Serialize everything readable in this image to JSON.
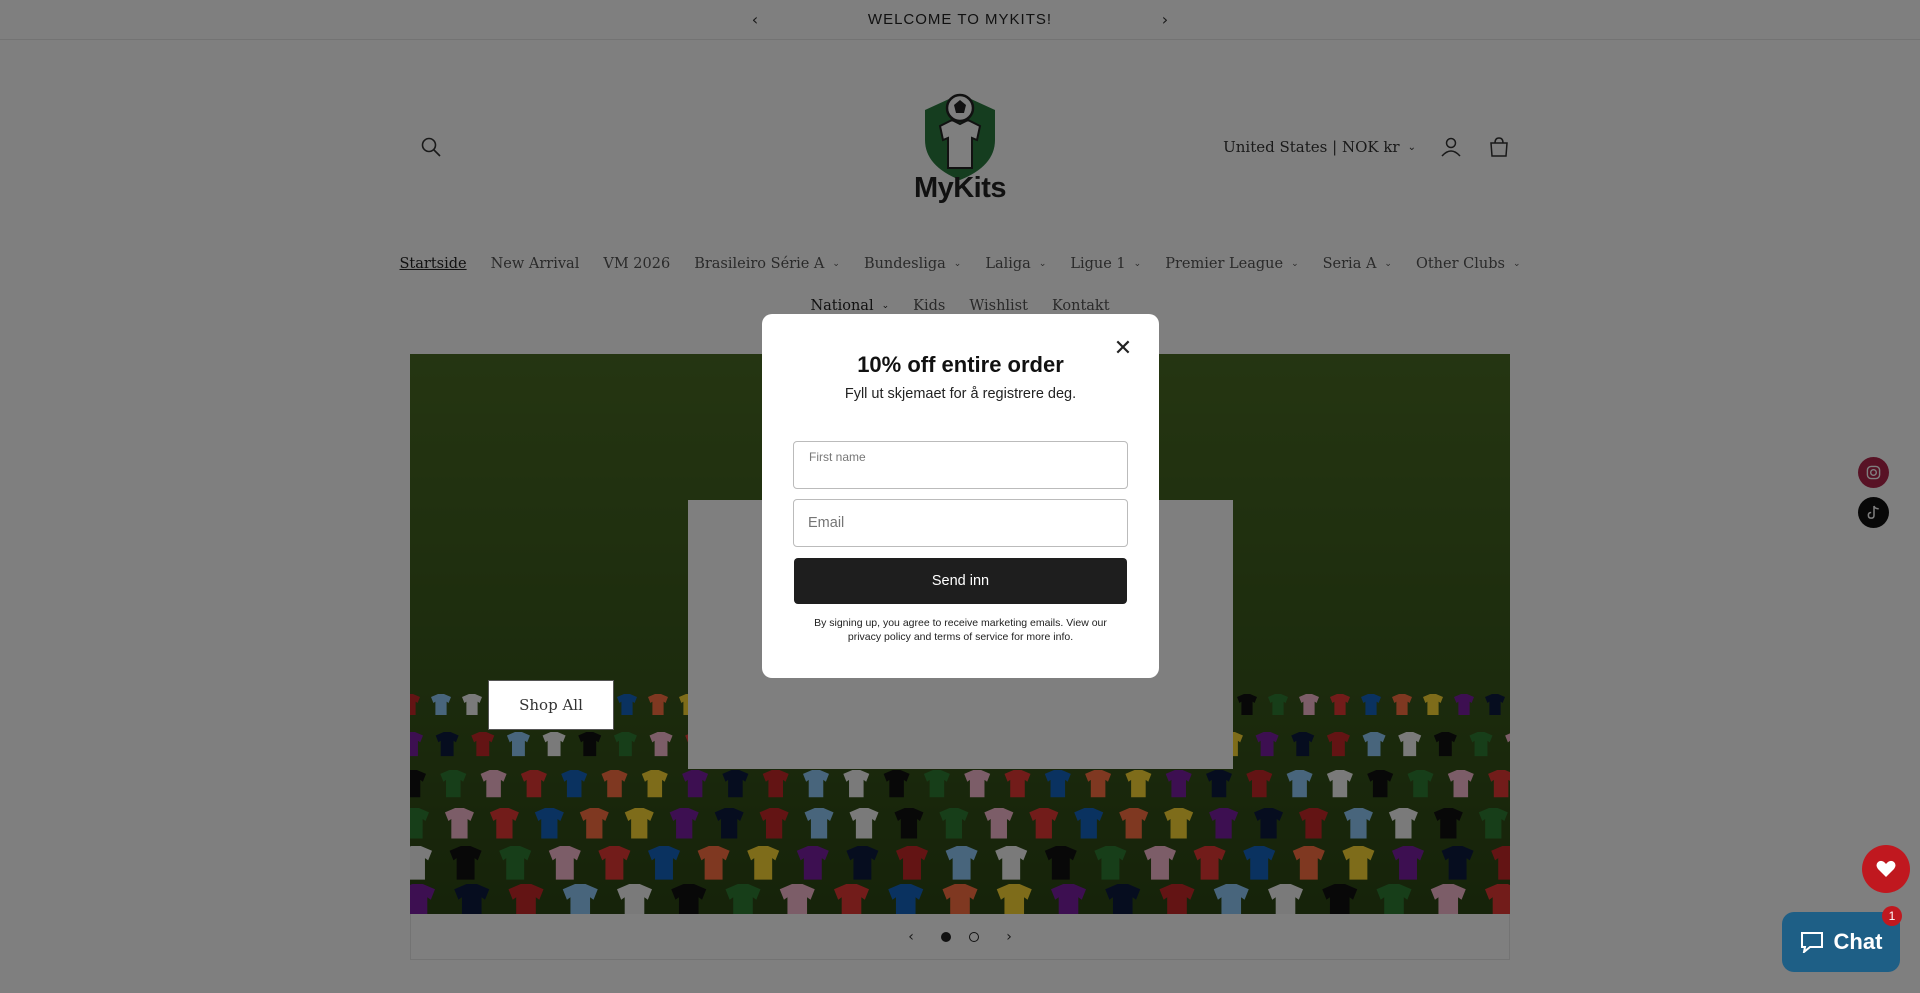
{
  "announcement": {
    "text": "WELCOME TO MYKITS!"
  },
  "logo": {
    "text": "MyKits"
  },
  "header": {
    "country_selector": "United States | NOK kr"
  },
  "nav": {
    "row1": [
      {
        "label": "Startside"
      },
      {
        "label": "New Arrival"
      },
      {
        "label": "VM 2026"
      },
      {
        "label": "Brasileiro Série A"
      },
      {
        "label": "Bundesliga"
      },
      {
        "label": "Laliga"
      },
      {
        "label": "Ligue 1"
      },
      {
        "label": "Premier League"
      },
      {
        "label": "Seria A"
      },
      {
        "label": "Other Clubs"
      }
    ],
    "row2": [
      {
        "label": "National"
      },
      {
        "label": "Kids"
      },
      {
        "label": "Wishlist"
      },
      {
        "label": "Kontakt"
      }
    ]
  },
  "hero": {
    "button_label": "Shop All",
    "slides": 2,
    "current_slide": 1
  },
  "popup": {
    "title": "10% off entire order",
    "subtitle": "Fyll ut skjemaet for å registrere deg.",
    "first_name_label": "First name",
    "email_placeholder": "Email",
    "submit_label": "Send inn",
    "disclaimer": "By signing up, you agree to receive marketing emails. View our privacy policy and terms of service for more info."
  },
  "chat": {
    "label": "Chat",
    "badge": "1"
  },
  "colors": {
    "brand_green": "#2b7a3f",
    "chat_blue": "#1e5f86",
    "wishlist_red": "#c0181f",
    "button_dark": "#1e1e1e"
  }
}
